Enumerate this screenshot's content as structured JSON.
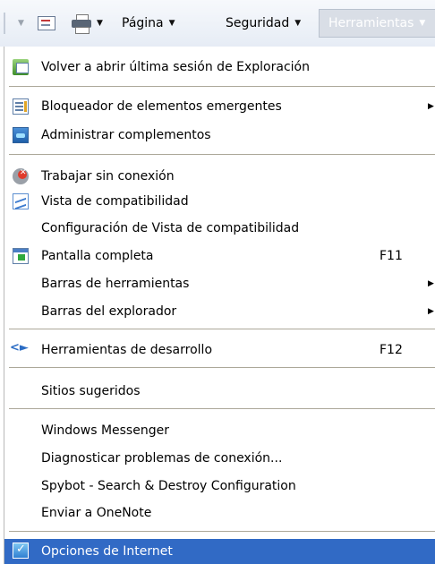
{
  "command_bar": {
    "feeds_icon": "feeds-icon",
    "print_icon": "print-icon",
    "page_label": "Página",
    "safety_label": "Seguridad",
    "tools_label": "Herramientas"
  },
  "menu": {
    "items": [
      {
        "label": "Volver a abrir última sesión de Exploración",
        "icon": "reopen-session-icon"
      },
      {
        "label": "Bloqueador de elementos emergentes",
        "icon": "popup-blocker-icon",
        "submenu": true
      },
      {
        "label": "Administrar complementos",
        "icon": "manage-addons-icon"
      },
      {
        "label": "Trabajar sin conexión",
        "icon": "work-offline-icon"
      },
      {
        "label": "Vista de compatibilidad",
        "icon": "compatibility-view-icon"
      },
      {
        "label": "Configuración de Vista de compatibilidad"
      },
      {
        "label": "Pantalla completa",
        "icon": "full-screen-icon",
        "shortcut": "F11"
      },
      {
        "label": "Barras de herramientas",
        "submenu": true
      },
      {
        "label": "Barras del explorador",
        "submenu": true
      },
      {
        "label": "Herramientas de desarrollo",
        "icon": "developer-tools-icon",
        "shortcut": "F12"
      },
      {
        "label": "Sitios sugeridos"
      },
      {
        "label": "Windows Messenger"
      },
      {
        "label": "Diagnosticar problemas de conexión..."
      },
      {
        "label": "Spybot - Search & Destroy Configuration"
      },
      {
        "label": "Enviar a OneNote"
      },
      {
        "label": "Opciones de Internet",
        "icon": "internet-options-icon",
        "highlighted": true
      }
    ]
  },
  "colors": {
    "highlight": "#316ac5",
    "highlight_text": "#ffffff",
    "separator": "#aca899"
  }
}
